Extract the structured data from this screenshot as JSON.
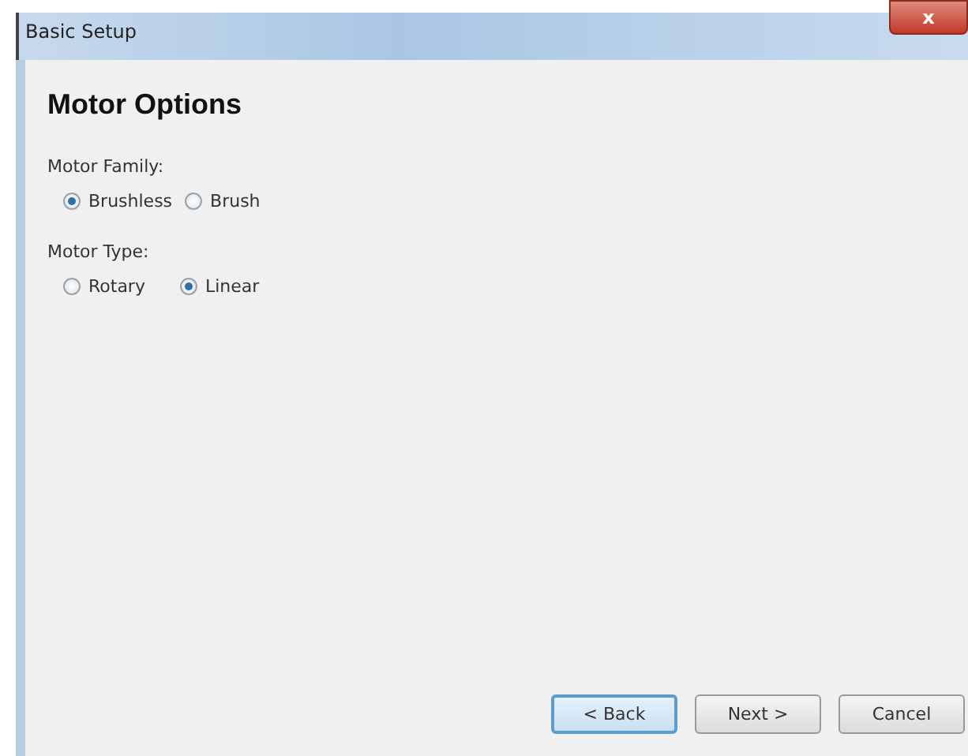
{
  "window": {
    "title": "Basic Setup",
    "close": "x"
  },
  "page": {
    "title": "Motor Options"
  },
  "groups": [
    {
      "label": "Motor Family:",
      "options": [
        {
          "label": "Brushless",
          "selected": true
        },
        {
          "label": "Brush",
          "selected": false
        }
      ]
    },
    {
      "label": "Motor Type:",
      "options": [
        {
          "label": "Rotary",
          "selected": false
        },
        {
          "label": "Linear",
          "selected": true
        }
      ]
    }
  ],
  "buttons": [
    {
      "label": "< Back",
      "default": true
    },
    {
      "label": "Next >",
      "default": false
    },
    {
      "label": "Cancel",
      "default": false
    }
  ]
}
